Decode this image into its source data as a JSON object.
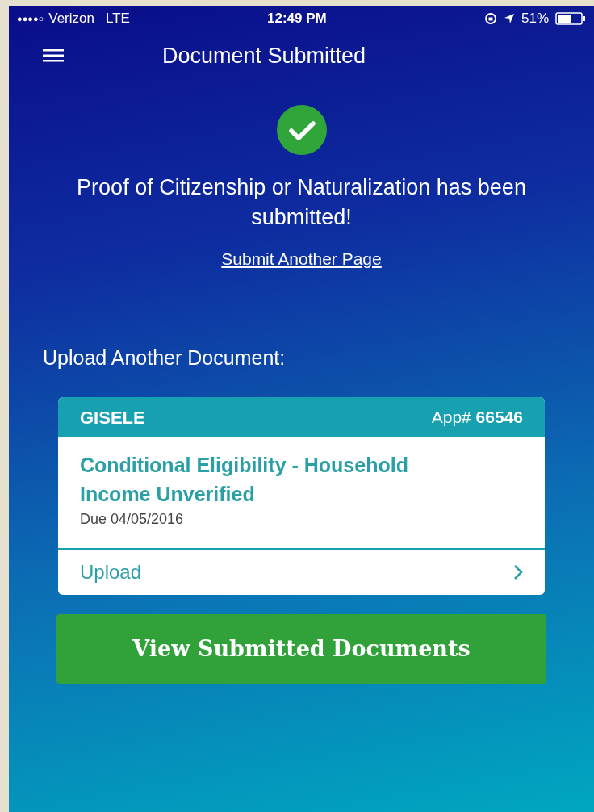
{
  "status_bar": {
    "signal_dots": "●●●●○",
    "carrier": "Verizon",
    "network": "LTE",
    "time": "12:49 PM",
    "battery": "51%"
  },
  "nav": {
    "title": "Document Submitted"
  },
  "confirmation": {
    "message": "Proof of Citizenship or Naturalization has been submitted!",
    "link": "Submit Another Page"
  },
  "section_title": "Upload Another Document:",
  "card": {
    "name": "GISELE",
    "app_number": "App# **66546**",
    "title": "Conditional Eligibility - Household Income Unverified",
    "due": "Due 04/05/2016",
    "action": "Upload"
  },
  "primary_button": "View Submitted Documents"
}
